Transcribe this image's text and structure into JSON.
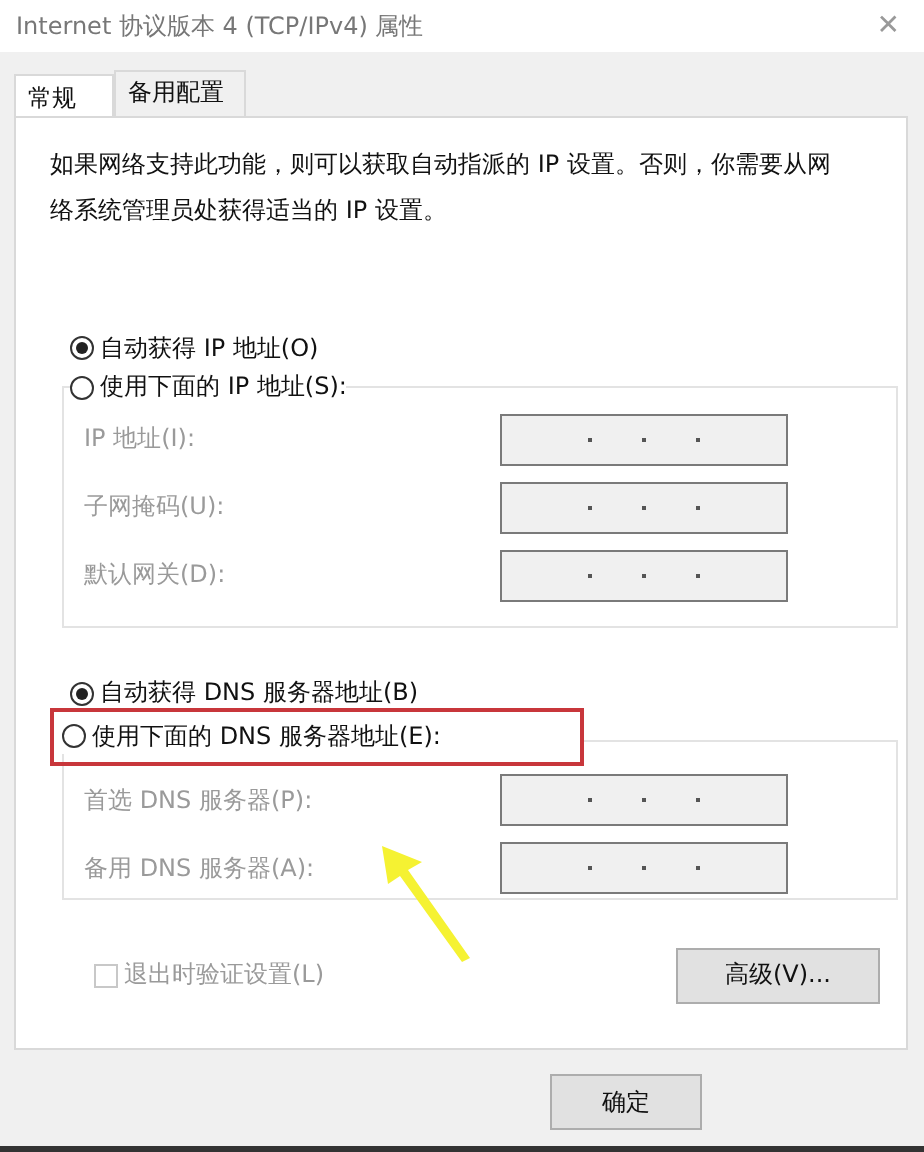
{
  "window": {
    "title": "Internet 协议版本 4 (TCP/IPv4) 属性",
    "close": "✕"
  },
  "tabs": [
    {
      "label": "常规",
      "selected": true
    },
    {
      "label": "备用配置",
      "selected": false
    }
  ],
  "description": "如果网络支持此功能，则可以获取自动指派的 IP 设置。否则，你需要从网络系统管理员处获得适当的 IP 设置。",
  "ip_mode": [
    {
      "label": "自动获得 IP 地址(O)",
      "selected": true
    },
    {
      "label": "使用下面的 IP 地址(S):",
      "selected": false
    }
  ],
  "ip_fields": [
    {
      "label": "IP 地址(I):",
      "disabled": true
    },
    {
      "label": "子网掩码(U):",
      "disabled": true
    },
    {
      "label": "默认网关(D):",
      "disabled": true
    }
  ],
  "dns_mode": [
    {
      "label": "自动获得 DNS 服务器地址(B)",
      "selected": true
    },
    {
      "label": "使用下面的 DNS 服务器地址(E):",
      "selected": false
    }
  ],
  "dns_fields": [
    {
      "label": "首选 DNS 服务器(P):",
      "disabled": true
    },
    {
      "label": "备用 DNS 服务器(A):",
      "disabled": true
    }
  ],
  "validate_checkbox": {
    "label": "退出时验证设置(L)",
    "checked": false,
    "disabled": true
  },
  "advanced_button": "高级(V)...",
  "buttons": [
    "确定"
  ]
}
